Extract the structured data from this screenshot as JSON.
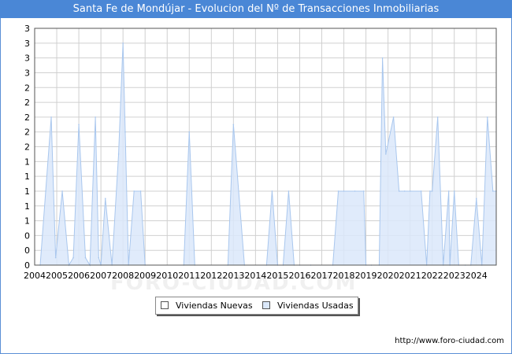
{
  "title": "Santa Fe de Mondújar - Evolucion del Nº de Transacciones Inmobiliarias",
  "footer_url": "http://www.foro-ciudad.com",
  "watermark": "FORO-CIUDAD.COM",
  "colors": {
    "title_bar": "#4a87d6",
    "nuevas_fill": "#ffffff",
    "usadas_fill": "#dbe8fa",
    "usadas_line": "#a9c7ee",
    "grid": "#d0d0d0"
  },
  "legend": {
    "nuevas": "Viviendas Nuevas",
    "usadas": "Viviendas Usadas"
  },
  "chart_data": {
    "type": "area",
    "title": "Santa Fe de Mondújar - Evolucion del Nº de Transacciones Inmobiliarias",
    "xlim": [
      2004,
      2024.9
    ],
    "ylim": [
      0,
      3.2
    ],
    "y_ticks": [
      0,
      0.2,
      0.4,
      0.6,
      0.8,
      1.0,
      1.2,
      1.4,
      1.6,
      1.8,
      2.0,
      2.2,
      2.4,
      2.6,
      2.8,
      3.0,
      3.2
    ],
    "y_tick_labels": [
      "0",
      "0",
      "0",
      "1",
      "1",
      "1",
      "1",
      "1",
      "2",
      "2",
      "2",
      "2",
      "2",
      "3",
      "3",
      "3",
      "3"
    ],
    "x_tick_labels": [
      "2004",
      "2005",
      "2006",
      "2007",
      "2008",
      "2009",
      "2010",
      "2011",
      "2012",
      "2013",
      "2014",
      "2015",
      "2016",
      "2017",
      "2018",
      "2019",
      "2020",
      "2021",
      "2022",
      "2023",
      "2024"
    ],
    "grid": true,
    "legend_position": "bottom-center",
    "series": [
      {
        "name": "Viviendas Nuevas",
        "x": [],
        "y": []
      },
      {
        "name": "Viviendas Usadas",
        "x": [
          2004.25,
          2004.5,
          2004.75,
          2004.95,
          2005.25,
          2005.55,
          2005.75,
          2006.0,
          2006.3,
          2006.5,
          2006.75,
          2006.9,
          2007.0,
          2007.2,
          2007.5,
          2007.8,
          2008.0,
          2008.1,
          2008.25,
          2008.5,
          2008.8,
          2009.0,
          2010.75,
          2011.0,
          2011.25,
          2012.75,
          2013.0,
          2013.5,
          2014.5,
          2014.75,
          2015.0,
          2015.25,
          2015.5,
          2015.75,
          2016.0,
          2016.5,
          2017.5,
          2017.75,
          2018.0,
          2018.5,
          2018.9,
          2019.0,
          2019.25,
          2019.6,
          2019.75,
          2019.9,
          2020.25,
          2020.5,
          2020.75,
          2021.0,
          2021.5,
          2021.75,
          2021.9,
          2022.0,
          2022.25,
          2022.5,
          2022.75,
          2022.8,
          2023.0,
          2023.2,
          2023.5,
          2023.75,
          2024.0,
          2024.25,
          2024.5,
          2024.75,
          2024.9
        ],
        "y": [
          0,
          1.0,
          2.0,
          0.1,
          1.0,
          0.0,
          0.1,
          1.9,
          0.1,
          0.0,
          2.0,
          0.1,
          0.0,
          0.9,
          0.0,
          1.5,
          3.0,
          1.8,
          0.0,
          1.0,
          1.0,
          0.0,
          0.0,
          1.8,
          0.0,
          0.0,
          1.9,
          0.0,
          0.0,
          1.0,
          0.0,
          0.0,
          1.0,
          0.0,
          0.0,
          0.0,
          0.0,
          1.0,
          1.0,
          1.0,
          1.0,
          0.0,
          0.0,
          0.0,
          2.8,
          1.5,
          2.0,
          1.0,
          1.0,
          1.0,
          1.0,
          0.0,
          1.0,
          1.0,
          2.0,
          0.0,
          1.0,
          0.0,
          1.0,
          0.0,
          0.0,
          0.0,
          0.9,
          0.0,
          2.0,
          1.0,
          1.0
        ]
      }
    ]
  }
}
